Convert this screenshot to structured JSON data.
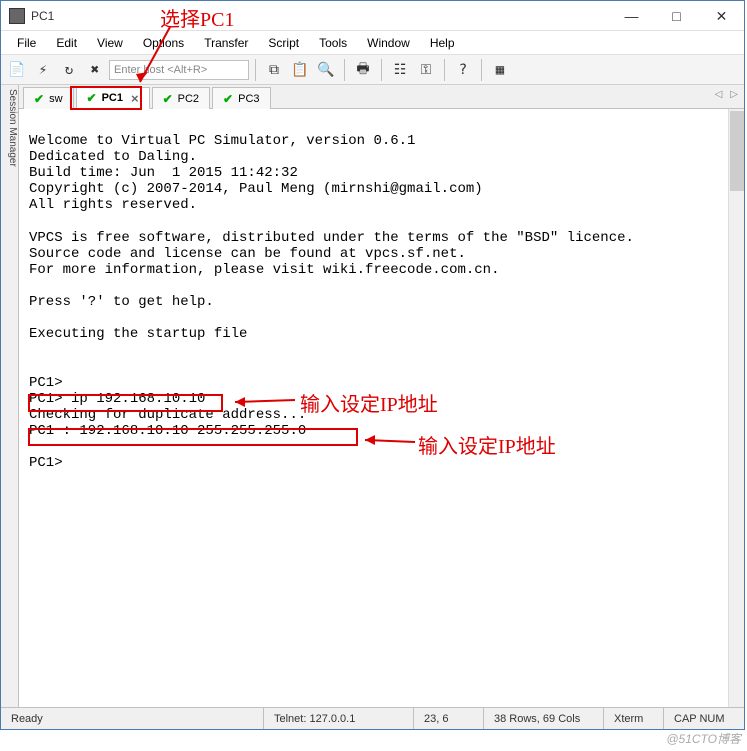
{
  "window": {
    "title": "PC1",
    "controls": {
      "min": "—",
      "max": "□",
      "close": "✕"
    }
  },
  "menu": {
    "items": [
      "File",
      "Edit",
      "View",
      "Options",
      "Transfer",
      "Script",
      "Tools",
      "Window",
      "Help"
    ]
  },
  "toolbar": {
    "icons": [
      "folder",
      "bolt",
      "reconnect",
      "cross"
    ],
    "host_placeholder": "Enter host <Alt+R>",
    "icons2": [
      "copy",
      "paste",
      "find",
      "",
      "print",
      "",
      "props",
      "key",
      "",
      "help",
      "",
      "tile"
    ]
  },
  "sidebar": {
    "label": "Session Manager"
  },
  "tabs": {
    "list": [
      {
        "label": "sw",
        "active": false,
        "closable": false
      },
      {
        "label": "PC1",
        "active": true,
        "closable": true
      },
      {
        "label": "PC2",
        "active": false,
        "closable": false
      },
      {
        "label": "PC3",
        "active": false,
        "closable": false
      }
    ],
    "nav_left": "◁",
    "nav_right": "▷"
  },
  "terminal": {
    "lines": [
      "",
      "Welcome to Virtual PC Simulator, version 0.6.1",
      "Dedicated to Daling.",
      "Build time: Jun  1 2015 11:42:32",
      "Copyright (c) 2007-2014, Paul Meng (mirnshi@gmail.com)",
      "All rights reserved.",
      "",
      "VPCS is free software, distributed under the terms of the \"BSD\" licence.",
      "Source code and license can be found at vpcs.sf.net.",
      "For more information, please visit wiki.freecode.com.cn.",
      "",
      "Press '?' to get help.",
      "",
      "Executing the startup file",
      "",
      "",
      "PC1>",
      "PC1> ip 192.168.10.10",
      "Checking for duplicate address...",
      "PC1 : 192.168.10.10 255.255.255.0",
      "",
      "PC1>"
    ]
  },
  "status": {
    "ready": "Ready",
    "telnet": "Telnet: 127.0.0.1",
    "pos": "23,   6",
    "size": "38 Rows, 69 Cols",
    "term": "Xterm",
    "caps": "CAP  NUM"
  },
  "annotations": {
    "top_label": "选择PC1",
    "mid_label": "输入设定IP地址",
    "bottom_label": "输入设定IP地址"
  },
  "watermark": "@51CTO博客"
}
